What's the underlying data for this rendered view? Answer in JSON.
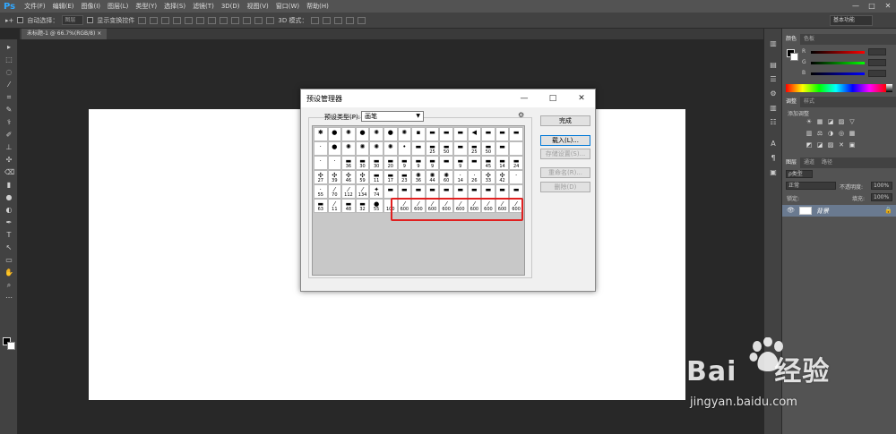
{
  "app": {
    "logo": "Ps",
    "menu": [
      "文件(F)",
      "编辑(E)",
      "图像(I)",
      "图层(L)",
      "类型(Y)",
      "选择(S)",
      "滤镜(T)",
      "3D(D)",
      "视图(V)",
      "窗口(W)",
      "帮助(H)"
    ],
    "window_controls": [
      "—",
      "□",
      "✕"
    ]
  },
  "options_bar": {
    "auto_select_label": "自动选择：",
    "auto_select_value": "图层",
    "show_transform_label": "显示变换控件",
    "mode_label": "3D 模式：",
    "workspace": "基本功能"
  },
  "document_tab": {
    "label": "未标题-1 @ 66.7%(RGB/8)",
    "close": "×"
  },
  "tools": [
    "▸",
    "⬚",
    "◌",
    "⁄",
    "⌗",
    "✎",
    "⚕",
    "✐",
    "⊥",
    "✣",
    "⌫",
    "▮",
    "●",
    "◐",
    "✒",
    "T",
    "↖",
    "▭",
    "✋",
    "⌕",
    "⋯"
  ],
  "right_icons": [
    "▥",
    "▤",
    "☰",
    "⚙",
    "▥",
    "☷",
    "A",
    "¶",
    "▣"
  ],
  "panels": {
    "color_tabs": [
      "颜色",
      "色板"
    ],
    "color_channels": [
      "R",
      "G",
      "B"
    ],
    "color_values": [
      "",
      "",
      ""
    ],
    "adjust_tabs": [
      "调整",
      "样式"
    ],
    "adjust_hint": "添加调整",
    "adjust_icons_row1": [
      "☀",
      "▦",
      "◪",
      "▨",
      "▽"
    ],
    "adjust_icons_row2": [
      "▥",
      "⚖",
      "◑",
      "◎",
      "▦"
    ],
    "adjust_icons_row3": [
      "◩",
      "◪",
      "▨",
      "✕",
      "▣"
    ],
    "layer_tabs": [
      "图层",
      "通道",
      "路径"
    ],
    "layer_filter": "ρ类型",
    "blend_mode": "正常",
    "opacity_label": "不透明度:",
    "opacity_value": "100%",
    "lock_label": "锁定:",
    "fill_label": "填充:",
    "fill_value": "100%",
    "layer_name": "背景",
    "lock_icon": "🔒",
    "eye_icon": "👁"
  },
  "dialog": {
    "title": "预设管理器",
    "preset_type_label": "预设类型(P):",
    "preset_type_value": "画笔",
    "buttons": {
      "done": "完成",
      "load": "载入(L)...",
      "save": "存储设置(S)...",
      "rename": "重命名(R)...",
      "delete": "删除(D)"
    },
    "rows": [
      [
        {
          "g": "✱",
          "n": ""
        },
        {
          "g": "●",
          "n": ""
        },
        {
          "g": "✺",
          "n": ""
        },
        {
          "g": "●",
          "n": ""
        },
        {
          "g": "✺",
          "n": ""
        },
        {
          "g": "●",
          "n": ""
        },
        {
          "g": "✺",
          "n": ""
        },
        {
          "g": "▪",
          "n": ""
        },
        {
          "g": "▬",
          "n": ""
        },
        {
          "g": "▬",
          "n": ""
        },
        {
          "g": "▬",
          "n": ""
        },
        {
          "g": "◀",
          "n": ""
        },
        {
          "g": "▬",
          "n": ""
        },
        {
          "g": "▬",
          "n": ""
        },
        {
          "g": "▬",
          "n": ""
        }
      ],
      [
        {
          "g": "·",
          "n": ""
        },
        {
          "g": "●",
          "n": ""
        },
        {
          "g": "✺",
          "n": ""
        },
        {
          "g": "✺",
          "n": ""
        },
        {
          "g": "✺",
          "n": ""
        },
        {
          "g": "✺",
          "n": ""
        },
        {
          "g": "•",
          "n": ""
        },
        {
          "g": "▬",
          "n": ""
        },
        {
          "g": "▬",
          "n": "25"
        },
        {
          "g": "▬",
          "n": "50"
        },
        {
          "g": "▬",
          "n": ""
        },
        {
          "g": "▬",
          "n": "25"
        },
        {
          "g": "▬",
          "n": "50"
        },
        {
          "g": "▬",
          "n": ""
        },
        {
          "g": "",
          "n": ""
        }
      ],
      [
        {
          "g": "·",
          "n": ""
        },
        {
          "g": "·",
          "n": ""
        },
        {
          "g": "▬",
          "n": "36"
        },
        {
          "g": "▬",
          "n": "30"
        },
        {
          "g": "▬",
          "n": "30"
        },
        {
          "g": "▬",
          "n": "20"
        },
        {
          "g": "▬",
          "n": "9"
        },
        {
          "g": "▬",
          "n": "9"
        },
        {
          "g": "▬",
          "n": "9"
        },
        {
          "g": "▬",
          "n": ""
        },
        {
          "g": "▬",
          "n": "9"
        },
        {
          "g": "▬",
          "n": ""
        },
        {
          "g": "▬",
          "n": "45"
        },
        {
          "g": "▬",
          "n": "14"
        },
        {
          "g": "▬",
          "n": "24"
        }
      ],
      [
        {
          "g": "✣",
          "n": "27"
        },
        {
          "g": "✣",
          "n": "39"
        },
        {
          "g": "✣",
          "n": "46"
        },
        {
          "g": "✣",
          "n": "59"
        },
        {
          "g": "▬",
          "n": "11"
        },
        {
          "g": "▬",
          "n": "17"
        },
        {
          "g": "▬",
          "n": "23"
        },
        {
          "g": "✺",
          "n": "36"
        },
        {
          "g": "✺",
          "n": "44"
        },
        {
          "g": "✺",
          "n": "60"
        },
        {
          "g": "·",
          "n": "14"
        },
        {
          "g": "·",
          "n": "26"
        },
        {
          "g": "✣",
          "n": "33"
        },
        {
          "g": "✣",
          "n": "42"
        },
        {
          "g": "·",
          "n": ""
        }
      ],
      [
        {
          "g": "·",
          "n": "55"
        },
        {
          "g": "⁄",
          "n": "70"
        },
        {
          "g": "⁄",
          "n": "112"
        },
        {
          "g": "⁄",
          "n": "134"
        },
        {
          "g": "✦",
          "n": "74"
        },
        {
          "g": "▬",
          "n": ""
        },
        {
          "g": "▬",
          "n": ""
        },
        {
          "g": "▬",
          "n": ""
        },
        {
          "g": "▬",
          "n": ""
        },
        {
          "g": "▬",
          "n": ""
        },
        {
          "g": "▬",
          "n": ""
        },
        {
          "g": "▬",
          "n": ""
        },
        {
          "g": "▬",
          "n": ""
        },
        {
          "g": "▬",
          "n": ""
        },
        {
          "g": "▬",
          "n": ""
        }
      ],
      [
        {
          "g": "▬",
          "n": "63"
        },
        {
          "g": "⁄",
          "n": "11"
        },
        {
          "g": "▬",
          "n": "48"
        },
        {
          "g": "▬",
          "n": "32"
        },
        {
          "g": "●",
          "n": "55"
        },
        {
          "g": "",
          "n": "100"
        },
        {
          "g": "⁄",
          "n": "600"
        },
        {
          "g": "⁄",
          "n": "600"
        },
        {
          "g": "⁄",
          "n": "600"
        },
        {
          "g": "⁄",
          "n": "600"
        },
        {
          "g": "⁄",
          "n": "600"
        },
        {
          "g": "⁄",
          "n": "600"
        },
        {
          "g": "⁄",
          "n": "600"
        },
        {
          "g": "⁄",
          "n": "600"
        },
        {
          "g": "⁄",
          "n": "600"
        }
      ]
    ]
  },
  "watermark": {
    "brand": "Bai",
    "suffix": "经验",
    "url": "jingyan.baidu.com"
  }
}
